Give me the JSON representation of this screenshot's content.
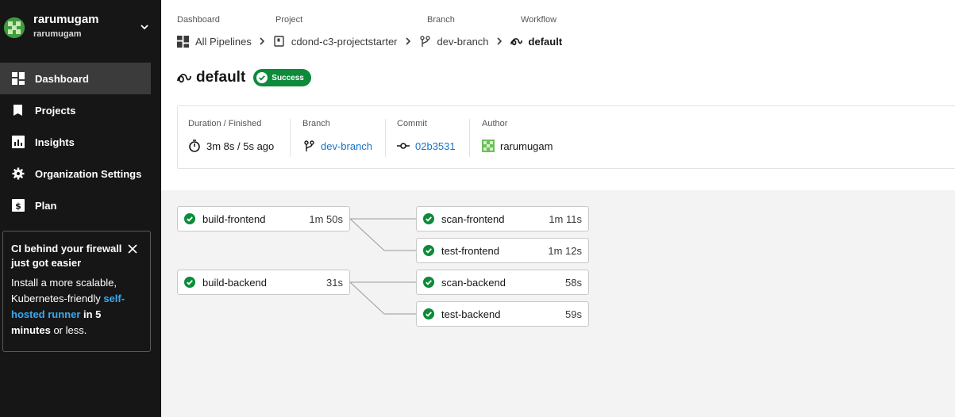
{
  "user": {
    "name": "rarumugam",
    "org": "rarumugam"
  },
  "nav": {
    "items": [
      {
        "label": "Dashboard",
        "icon": "dashboard-icon",
        "active": true
      },
      {
        "label": "Projects",
        "icon": "projects-icon",
        "active": false
      },
      {
        "label": "Insights",
        "icon": "insights-icon",
        "active": false
      },
      {
        "label": "Organization Settings",
        "icon": "gear-icon",
        "active": false
      },
      {
        "label": "Plan",
        "icon": "plan-icon",
        "active": false
      }
    ]
  },
  "promo": {
    "title": "CI behind your firewall just got easier",
    "body_before": "Install a more scalable, Kubernetes-friendly ",
    "link": "self-hosted runner",
    "body_bold": " in 5 minutes",
    "body_after": " or less."
  },
  "breadcrumb": {
    "labels": [
      "Dashboard",
      "Project",
      "Branch",
      "Workflow"
    ],
    "all_pipelines": "All Pipelines",
    "project": "cdond-c3-projectstarter",
    "branch": "dev-branch",
    "workflow": "default"
  },
  "workflow": {
    "title": "default",
    "status": "Success",
    "status_color": "#0d8a3a"
  },
  "info": {
    "duration_label": "Duration / Finished",
    "duration_value": "3m 8s / 5s ago",
    "branch_label": "Branch",
    "branch_value": "dev-branch",
    "commit_label": "Commit",
    "commit_value": "02b3531",
    "author_label": "Author",
    "author_value": "rarumugam"
  },
  "jobs": {
    "build_frontend": {
      "name": "build-frontend",
      "duration": "1m 50s",
      "status": "success"
    },
    "scan_frontend": {
      "name": "scan-frontend",
      "duration": "1m 11s",
      "status": "success"
    },
    "test_frontend": {
      "name": "test-frontend",
      "duration": "1m 12s",
      "status": "success"
    },
    "build_backend": {
      "name": "build-backend",
      "duration": "31s",
      "status": "success"
    },
    "scan_backend": {
      "name": "scan-backend",
      "duration": "58s",
      "status": "success"
    },
    "test_backend": {
      "name": "test-backend",
      "duration": "59s",
      "status": "success"
    }
  },
  "colors": {
    "sidebar_bg": "#161616",
    "success": "#0d8a3a",
    "link": "#1874c8",
    "promo_link": "#39a9f2"
  }
}
